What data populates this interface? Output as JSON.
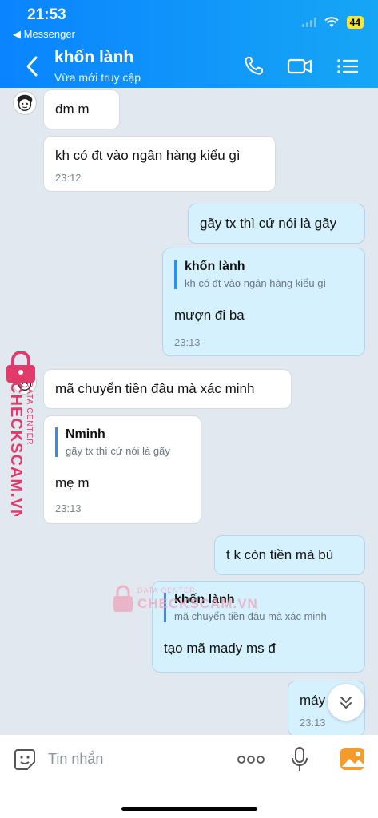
{
  "status": {
    "time": "21:53",
    "back_app": "◀ Messenger",
    "battery": "44"
  },
  "header": {
    "contact_name": "khốn lành",
    "contact_status": "Vừa mới truy cập"
  },
  "messages": [
    {
      "text": "đm m"
    },
    {
      "text": "kh có đt vào ngân hàng kiểu gì",
      "time": "23:12"
    },
    {
      "text": "gãy tx thì cứ nói là gãy"
    },
    {
      "quote_name": "khốn lành",
      "quote_text": "kh có đt vào ngân hàng kiểu gì",
      "text": "mượn đi ba",
      "time": "23:13"
    },
    {
      "text": "mã chuyển tiền đâu mà xác minh"
    },
    {
      "quote_name": "Nminh",
      "quote_text": "gãy tx thì cứ nói là gãy",
      "text": "mẹ m",
      "time": "23:13"
    },
    {
      "text": "t k còn tiền mà bù"
    },
    {
      "quote_name": "khốn lành",
      "quote_text": "mã chuyển tiền đâu mà xác minh",
      "text": "tạo mã mady ms đ"
    },
    {
      "text": "máy",
      "time": "23:13"
    }
  ],
  "watermark": {
    "top": "DATA CENTER",
    "brand": "CHECKSCAM.VN"
  },
  "input": {
    "placeholder": "Tin nhắn"
  },
  "colors": {
    "header": "#0a84ff",
    "outgoing_bubble": "#d5f1fe",
    "incoming_bubble": "#ffffff",
    "chat_bg": "#e2e8ef",
    "quote_bar": "#2f8cf5",
    "watermark": "#e23b6b"
  }
}
